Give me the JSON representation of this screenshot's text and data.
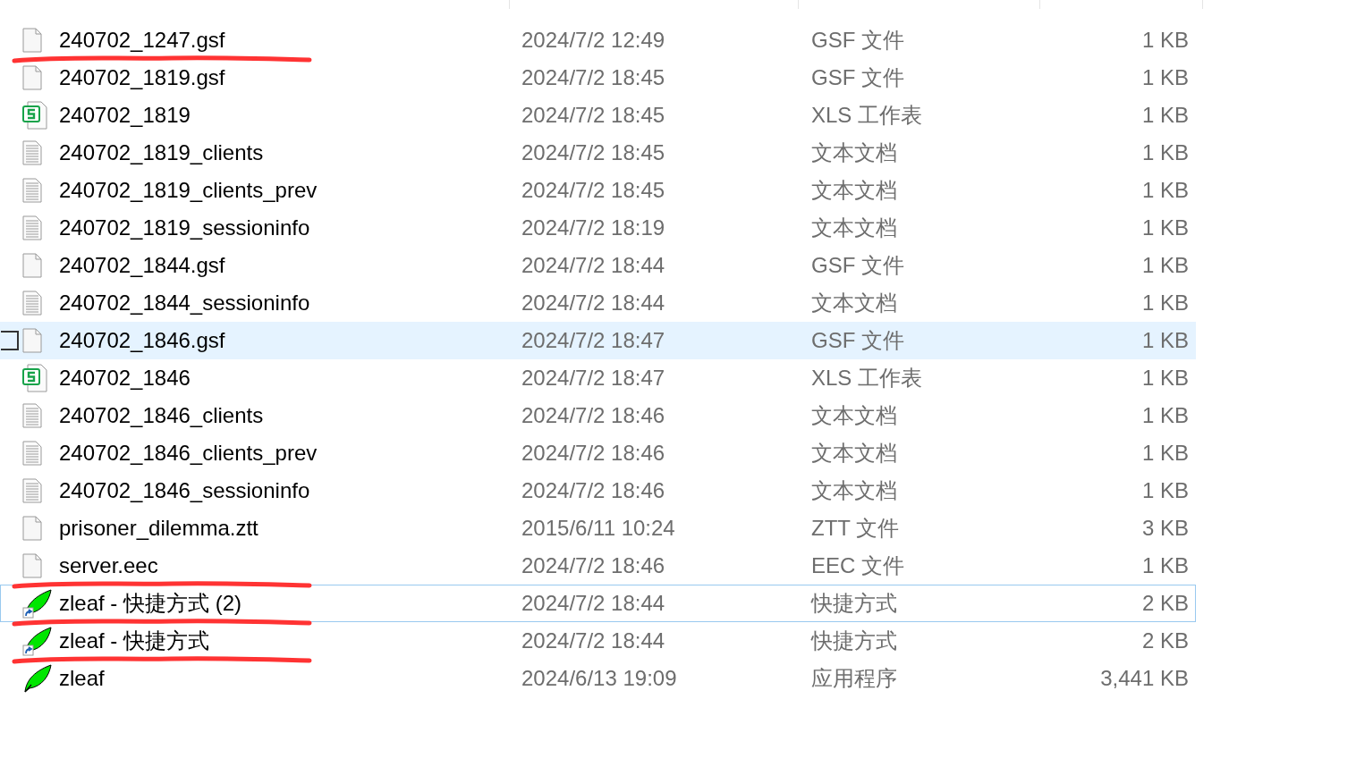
{
  "files": [
    {
      "name": "240702_1247.gsf",
      "modified": "2024/7/2 12:49",
      "type": "GSF 文件",
      "size": "1 KB",
      "kind": "blank",
      "selected": false,
      "focused": false,
      "marked": true
    },
    {
      "name": "240702_1819.gsf",
      "modified": "2024/7/2 18:45",
      "type": "GSF 文件",
      "size": "1 KB",
      "kind": "blank",
      "selected": false,
      "focused": false,
      "marked": false
    },
    {
      "name": "240702_1819",
      "modified": "2024/7/2 18:45",
      "type": "XLS 工作表",
      "size": "1 KB",
      "kind": "sheet",
      "selected": false,
      "focused": false,
      "marked": false
    },
    {
      "name": "240702_1819_clients",
      "modified": "2024/7/2 18:45",
      "type": "文本文档",
      "size": "1 KB",
      "kind": "text",
      "selected": false,
      "focused": false,
      "marked": false
    },
    {
      "name": "240702_1819_clients_prev",
      "modified": "2024/7/2 18:45",
      "type": "文本文档",
      "size": "1 KB",
      "kind": "text",
      "selected": false,
      "focused": false,
      "marked": false
    },
    {
      "name": "240702_1819_sessioninfo",
      "modified": "2024/7/2 18:19",
      "type": "文本文档",
      "size": "1 KB",
      "kind": "text",
      "selected": false,
      "focused": false,
      "marked": false
    },
    {
      "name": "240702_1844.gsf",
      "modified": "2024/7/2 18:44",
      "type": "GSF 文件",
      "size": "1 KB",
      "kind": "blank",
      "selected": false,
      "focused": false,
      "marked": false
    },
    {
      "name": "240702_1844_sessioninfo",
      "modified": "2024/7/2 18:44",
      "type": "文本文档",
      "size": "1 KB",
      "kind": "text",
      "selected": false,
      "focused": false,
      "marked": false
    },
    {
      "name": "240702_1846.gsf",
      "modified": "2024/7/2 18:47",
      "type": "GSF 文件",
      "size": "1 KB",
      "kind": "blank",
      "selected": true,
      "focused": false,
      "marked": false
    },
    {
      "name": "240702_1846",
      "modified": "2024/7/2 18:47",
      "type": "XLS 工作表",
      "size": "1 KB",
      "kind": "sheet",
      "selected": false,
      "focused": false,
      "marked": false
    },
    {
      "name": "240702_1846_clients",
      "modified": "2024/7/2 18:46",
      "type": "文本文档",
      "size": "1 KB",
      "kind": "text",
      "selected": false,
      "focused": false,
      "marked": false
    },
    {
      "name": "240702_1846_clients_prev",
      "modified": "2024/7/2 18:46",
      "type": "文本文档",
      "size": "1 KB",
      "kind": "text",
      "selected": false,
      "focused": false,
      "marked": false
    },
    {
      "name": "240702_1846_sessioninfo",
      "modified": "2024/7/2 18:46",
      "type": "文本文档",
      "size": "1 KB",
      "kind": "text",
      "selected": false,
      "focused": false,
      "marked": false
    },
    {
      "name": "prisoner_dilemma.ztt",
      "modified": "2015/6/11 10:24",
      "type": "ZTT 文件",
      "size": "3 KB",
      "kind": "blank",
      "selected": false,
      "focused": false,
      "marked": false
    },
    {
      "name": "server.eec",
      "modified": "2024/7/2 18:46",
      "type": "EEC 文件",
      "size": "1 KB",
      "kind": "blank",
      "selected": false,
      "focused": false,
      "marked": true
    },
    {
      "name": "zleaf - 快捷方式 (2)",
      "modified": "2024/7/2 18:44",
      "type": "快捷方式",
      "size": "2 KB",
      "kind": "leaf-shortcut",
      "selected": false,
      "focused": true,
      "marked": true
    },
    {
      "name": "zleaf - 快捷方式",
      "modified": "2024/7/2 18:44",
      "type": "快捷方式",
      "size": "2 KB",
      "kind": "leaf-shortcut",
      "selected": false,
      "focused": false,
      "marked": true
    },
    {
      "name": "zleaf",
      "modified": "2024/6/13 19:09",
      "type": "应用程序",
      "size": "3,441 KB",
      "kind": "leaf",
      "selected": false,
      "focused": false,
      "marked": false
    }
  ]
}
